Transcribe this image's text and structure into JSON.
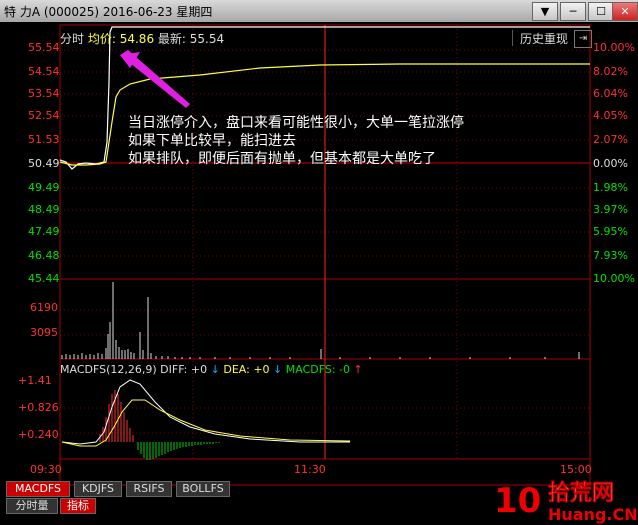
{
  "window": {
    "title": "特  力A (000025)  2016-06-23 星期四",
    "controls": [
      "下拉菜单",
      "最小化",
      "最大化",
      "关闭"
    ]
  },
  "header": {
    "mode_label": "分时",
    "avg_label": "均价:",
    "avg_value": "54.86",
    "last_label": "最新:",
    "last_value": "55.54",
    "history_button": "历史重现"
  },
  "price_axis_left": [
    "55.54",
    "54.54",
    "53.54",
    "52.54",
    "51.53",
    "50.49",
    "49.49",
    "48.49",
    "47.49",
    "46.48",
    "45.44"
  ],
  "pct_axis_right": [
    "10.00%",
    "8.02%",
    "6.04%",
    "4.05%",
    "2.07%",
    "0.00%",
    "1.98%",
    "3.97%",
    "5.95%",
    "7.93%",
    "10.00%"
  ],
  "volume_axis_left": [
    "6190",
    "3095"
  ],
  "volume_axis_right": [
    "10.00%"
  ],
  "macd": {
    "title": "MACDFS(12,26,9)",
    "diff_label": "DIFF:",
    "diff_value": "+0",
    "dea_label": "DEA:",
    "dea_value": "+0",
    "macdfs_label": "MACDFS:",
    "macdfs_value": "-0",
    "axis": [
      "+1.41",
      "+0.826",
      "+0.240"
    ]
  },
  "time_axis": [
    "09:30",
    "11:30",
    "15:00"
  ],
  "annotation": [
    "当日涨停介入，盘口来看可能性很小，大单一笔拉涨停",
    "如果下单比较早，能扫进去",
    "如果排队，即便后面有抛单，但基本都是大单吃了"
  ],
  "indicator_tabs": [
    "MACDFS",
    "KDJFS",
    "RSIFS",
    "BOLLFS"
  ],
  "bottom_tabs": [
    "分时量",
    "指标"
  ],
  "watermark": {
    "text1": "拾荒网",
    "text2": "Huang.CN",
    "number": "10"
  },
  "colors": {
    "up": "#ff3030",
    "down": "#00e000",
    "price_line": "#ffffff",
    "avg_line": "#ffff40",
    "annotation_arrow": "#e020e0"
  }
}
